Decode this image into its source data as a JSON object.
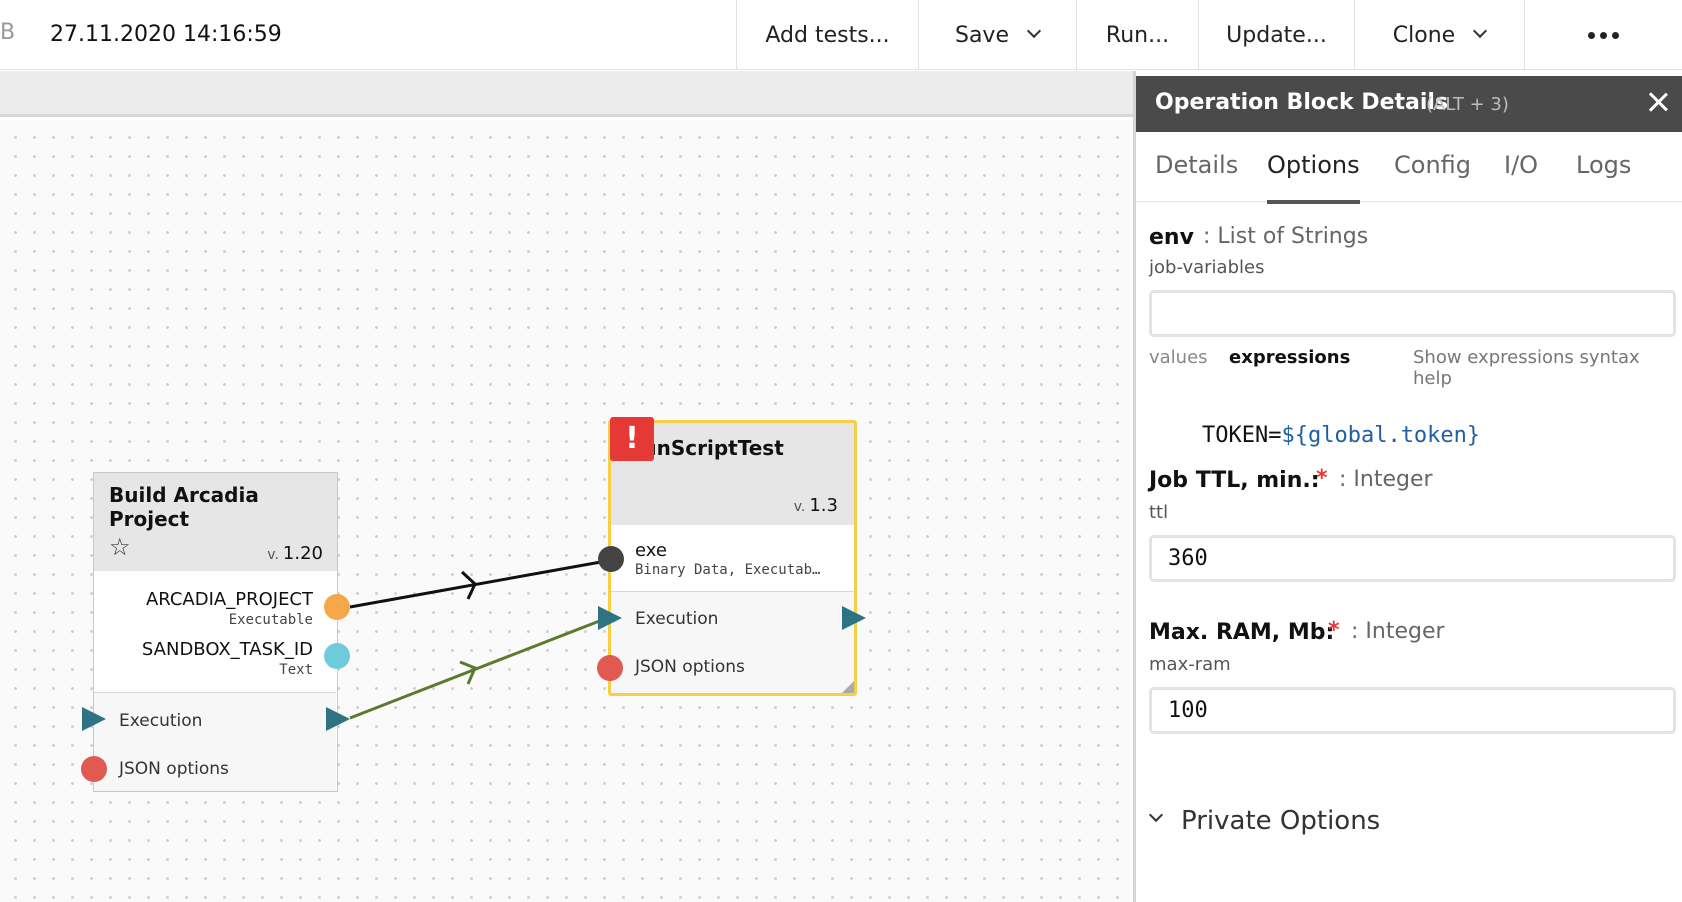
{
  "toolbar": {
    "cut_label": "B",
    "title": "27.11.2020 14:16:59",
    "add_tests": "Add tests...",
    "save": "Save",
    "run": "Run...",
    "update": "Update...",
    "clone": "Clone",
    "more_icon": "more-dots-icon"
  },
  "canvas": {
    "build_node": {
      "title": "Build Arcadia Project",
      "version_prefix": "v.",
      "version": "1.20",
      "star_icon": "star-icon",
      "outputs": [
        {
          "name": "ARCADIA_PROJECT",
          "type": "Executable",
          "color": "#f4a84a"
        },
        {
          "name": "SANDBOX_TASK_ID",
          "type": "Text",
          "color": "#6ecbdc"
        }
      ],
      "execution_label": "Execution",
      "json_label": "JSON options"
    },
    "run_node": {
      "title": "RunScriptTest",
      "version_prefix": "v.",
      "version": "1.3",
      "warning_glyph": "!",
      "input_name": "exe",
      "input_type": "Binary Data, Executab…",
      "execution_label": "Execution",
      "json_label": "JSON options",
      "border_color": "#f5cf48"
    },
    "colors": {
      "exec_triangle": "#2d7383",
      "json_dot": "#e05a52",
      "exe_dot": "#444444",
      "data_edge": "#111111",
      "exec_edge": "#5a7a2e",
      "warning": "#e53935"
    }
  },
  "panel": {
    "title": "Operation Block Details",
    "hint": "(ALT + 3)",
    "close_icon": "close-icon",
    "tabs": [
      "Details",
      "Options",
      "Config",
      "I/O",
      "Logs"
    ],
    "active_tab": "Options",
    "env": {
      "name": "env",
      "type": ": List of Strings",
      "key": "job-variables",
      "value": "",
      "mode_values": "values",
      "mode_expressions": "expressions",
      "syntax_help": "Show expressions syntax help",
      "expression_key": "TOKEN=",
      "expression_var": "${global.token}"
    },
    "ttl": {
      "name": "Job TTL, min.:",
      "required_mark": "*",
      "type": ": Integer",
      "key": "ttl",
      "value": "360"
    },
    "ram": {
      "name": "Max. RAM, Mb:",
      "required_mark": "*",
      "type": ": Integer",
      "key": "max-ram",
      "value": "100"
    },
    "private_options": "Private Options"
  }
}
